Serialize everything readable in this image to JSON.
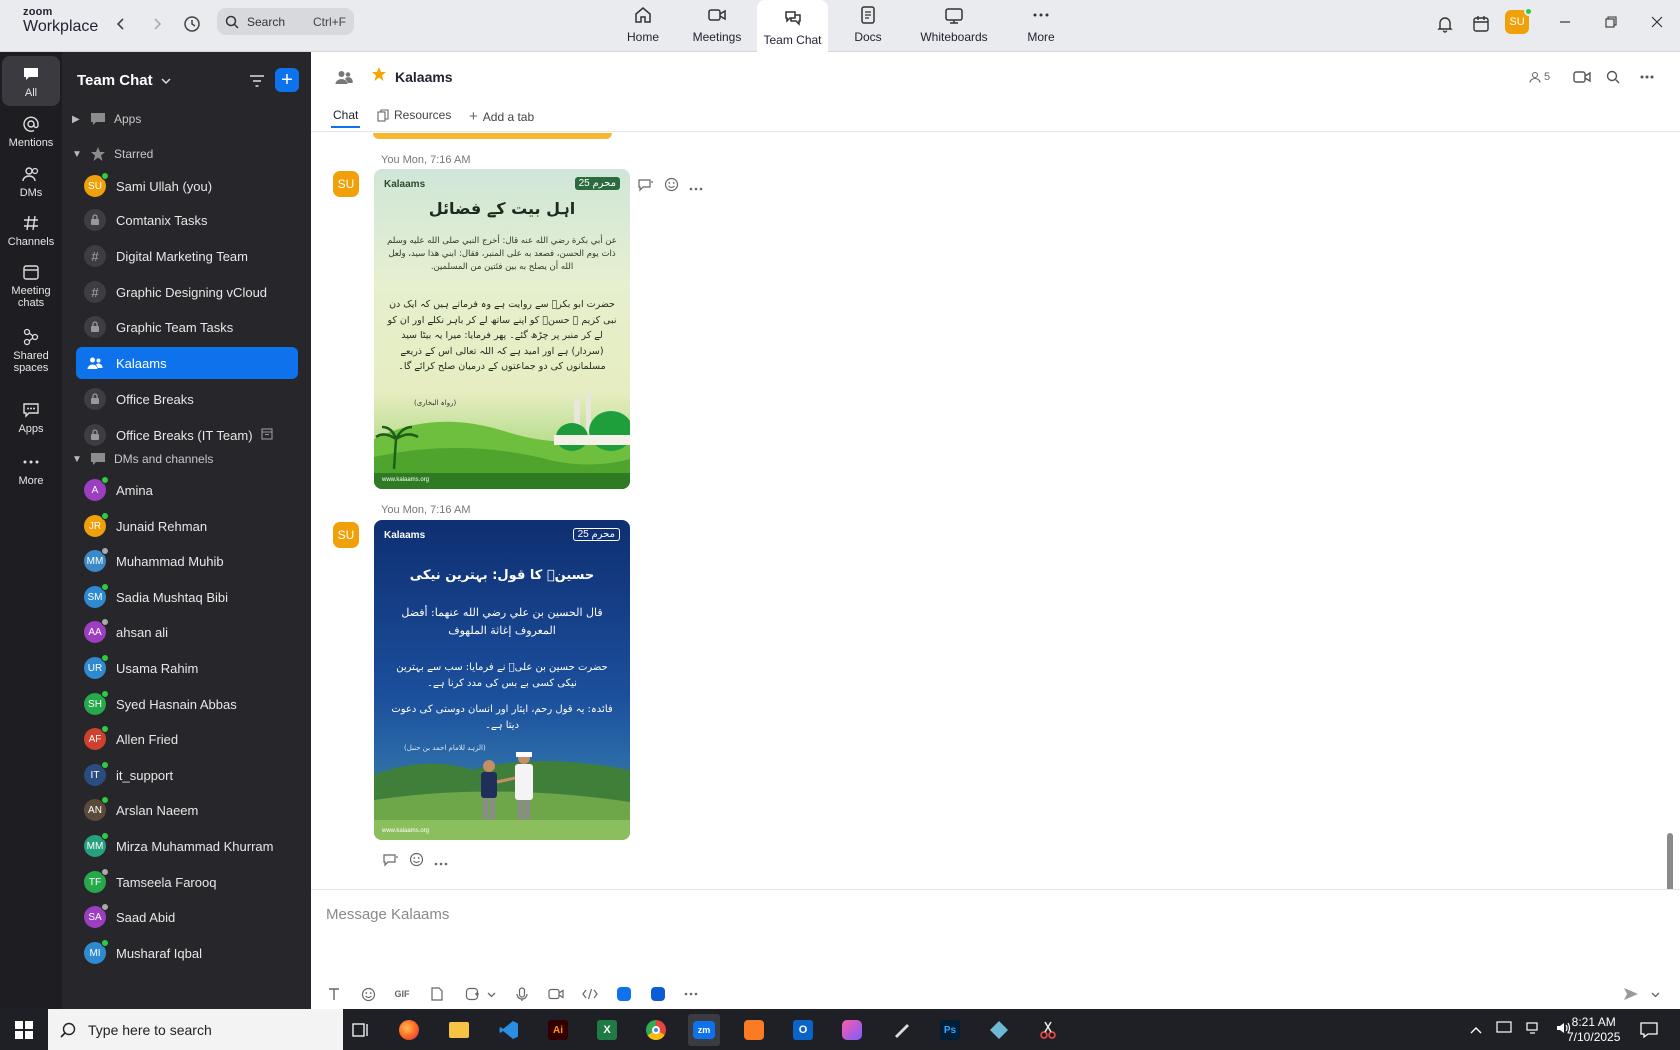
{
  "titlebar": {
    "logo_line1": "zoom",
    "logo_line2": "Workplace",
    "search_label": "Search",
    "search_shortcut": "Ctrl+F",
    "tabs": [
      {
        "label": "Home",
        "icon": "home-icon"
      },
      {
        "label": "Meetings",
        "icon": "video-icon"
      },
      {
        "label": "Team Chat",
        "icon": "chat-icon"
      },
      {
        "label": "Docs",
        "icon": "docs-icon"
      },
      {
        "label": "Whiteboards",
        "icon": "whiteboard-icon"
      },
      {
        "label": "More",
        "icon": "more-icon"
      }
    ],
    "user_initials": "SU"
  },
  "rail": {
    "items": [
      {
        "label": "All",
        "icon": "chat-bubble-icon"
      },
      {
        "label": "Mentions",
        "icon": "at-icon"
      },
      {
        "label": "DMs",
        "icon": "people-icon"
      },
      {
        "label": "Channels",
        "icon": "hash-icon"
      },
      {
        "label": "Meeting chats",
        "icon": "calendar-icon"
      },
      {
        "label": "Shared spaces",
        "icon": "share-icon"
      },
      {
        "label": "Apps",
        "icon": "apps-icon"
      },
      {
        "label": "More",
        "icon": "more-icon"
      }
    ]
  },
  "sidebar": {
    "title": "Team Chat",
    "sections": {
      "apps": "Apps",
      "starred": "Starred",
      "dms": "DMs and channels"
    },
    "starred": [
      {
        "label": "Sami Ullah (you)",
        "initials": "SU",
        "color": "#f0a008",
        "type": "user",
        "presence": "#2ecc40"
      },
      {
        "label": "Comtanix Tasks",
        "type": "private"
      },
      {
        "label": "Digital Marketing Team",
        "type": "channel"
      },
      {
        "label": "Graphic Designing vCloud",
        "type": "channel"
      },
      {
        "label": "Graphic Team Tasks",
        "type": "private"
      },
      {
        "label": "Kalaams",
        "type": "group",
        "active": true
      },
      {
        "label": "Office Breaks",
        "type": "private"
      },
      {
        "label": "Office Breaks (IT Team)",
        "type": "private"
      }
    ],
    "dms": [
      {
        "label": "Amina",
        "initials": "A",
        "color": "#9b3fc0",
        "presence": "#2ecc40"
      },
      {
        "label": "Junaid Rehman",
        "initials": "JR",
        "color": "#f0a008",
        "presence": "#2ecc40"
      },
      {
        "label": "Muhammad Muhib",
        "initials": "MM",
        "color": "#3c89c7",
        "presence": "#aaaaaa"
      },
      {
        "label": "Sadia Mushtaq Bibi",
        "initials": "SM",
        "color": "#2f8bd1",
        "presence": "#2ecc40"
      },
      {
        "label": "ahsan ali",
        "initials": "AA",
        "color": "#9b3fc0",
        "presence": "#aaaaaa"
      },
      {
        "label": "Usama Rahim",
        "initials": "UR",
        "color": "#2f8bd1",
        "presence": "#2ecc40"
      },
      {
        "label": "Syed Hasnain Abbas",
        "initials": "SH",
        "color": "#27a84a",
        "presence": "#2ecc40"
      },
      {
        "label": "Allen Fried",
        "initials": "AF",
        "color": "#d0402f",
        "presence": "#2ecc40"
      },
      {
        "label": "it_support",
        "initials": "IT",
        "color": "#2b4c7e",
        "presence": "#2ecc40"
      },
      {
        "label": "Arslan Naeem",
        "initials": "AN",
        "color": "#5a4a3a",
        "presence": "#2ecc40"
      },
      {
        "label": "Mirza Muhammad Khurram",
        "initials": "MM",
        "color": "#27a080",
        "presence": "#2ecc40"
      },
      {
        "label": "Tamseela Farooq",
        "initials": "TF",
        "color": "#27a84a",
        "presence": "#aaaaaa"
      },
      {
        "label": "Saad Abid",
        "initials": "SA",
        "color": "#9b3fc0",
        "presence": "#aaaaaa"
      },
      {
        "label": "Musharaf Iqbal",
        "initials": "MI",
        "color": "#2f8bd1",
        "presence": "#2ecc40"
      }
    ]
  },
  "channel": {
    "title": "Kalaams",
    "tabs": {
      "chat": "Chat",
      "resources": "Resources",
      "add": "Add a tab"
    },
    "member_count": "5"
  },
  "messages": [
    {
      "sender": "You",
      "time": "Mon, 7:16 AM",
      "initials": "SU",
      "card": {
        "brand": "Kalaams",
        "badge": "محرم 25",
        "heading": "اہل بیت کے فضائل",
        "arabic": "عن أبي بكرة رضي الله عنه قال: أخرج النبي صلى الله عليه وسلم ذات يوم الحسن، فصعد به على المنبر، فقال: ابني هذا سيد، ولعل الله أن يصلح به بين فئتين من المسلمين.",
        "urdu": "حضرت ابو بکرؓ سے روایت ہے وہ فرماتے ہیں کہ ایک دن نبی کریم ﷺ حسنؓ کو اپنے ساتھ لے کر باہر نکلے اور ان کو لے کر منبر پر چڑھ گئے۔ پھر فرمایا: میرا یہ بیٹا سید (سردار) ہے اور امید ہے کہ اللہ تعالی اس کے ذریعے مسلمانوں کی دو جماعتوں کے درمیان صلح کرائے گا۔",
        "source": "(رواہ البخاری)",
        "footer": "www.kalaams.org"
      }
    },
    {
      "sender": "You",
      "time": "Mon, 7:16 AM",
      "initials": "SU",
      "card": {
        "brand": "Kalaams",
        "badge": "محرم 25",
        "heading": "حسینؓ کا قول: بہترین نیکی",
        "arabic": "قال الحسين بن علي رضي الله عنهما: أفضل المعروف إغاثة الملهوف",
        "urdu": "حضرت حسین بن علیؓ نے فرمایا: سب سے بہترین نیکی کسی بے بس کی مدد کرنا ہے۔",
        "note": "فائدہ: یہ قول رحم، ایثار اور انسان دوستی کی دعوت دیتا ہے۔",
        "source": "(الزہد للامام احمد بن حنبل)",
        "footer": "www.kalaams.org"
      }
    }
  ],
  "composer": {
    "placeholder": "Message Kalaams"
  },
  "taskbar": {
    "search_placeholder": "Type here to search",
    "time": "8:21 AM",
    "date": "7/10/2025"
  }
}
